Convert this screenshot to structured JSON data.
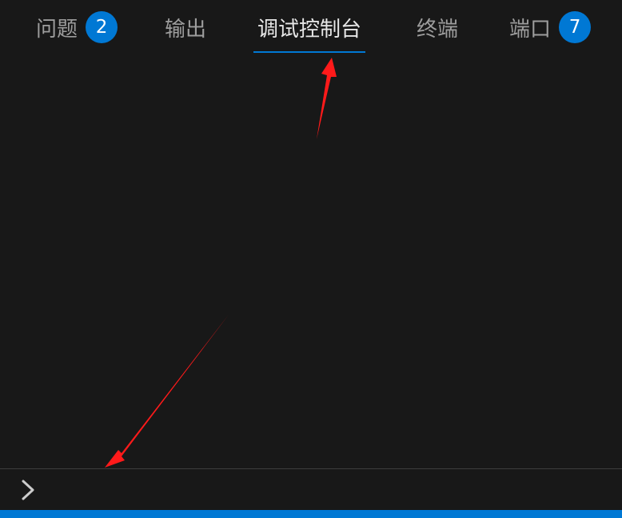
{
  "tabs": [
    {
      "label": "问题",
      "badge": "2",
      "active": false
    },
    {
      "label": "输出",
      "active": false
    },
    {
      "label": "调试控制台",
      "active": true
    },
    {
      "label": "终端",
      "active": false
    },
    {
      "label": "端口",
      "badge": "7",
      "active": false
    }
  ],
  "console": {
    "input_value": "",
    "prompt_icon": "chevron-right-icon"
  },
  "colors": {
    "background": "#181818",
    "accent": "#0078d4",
    "tab_inactive": "#9d9d9d",
    "tab_active": "#e7e7e7",
    "annotation_arrow": "#ff1a1a"
  }
}
